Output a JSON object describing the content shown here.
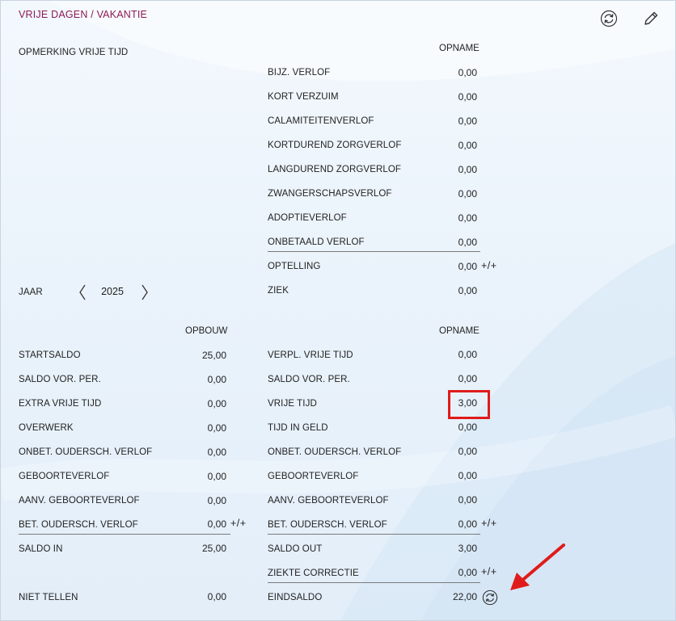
{
  "title": "VRIJE DAGEN / VAKANTIE",
  "icons": {
    "refresh": "refresh-icon",
    "edit": "pencil-icon"
  },
  "colors": {
    "title": "#8b1a55",
    "highlight": "#e01b1b"
  },
  "top": {
    "remark_label": "OPMERKING VRIJE TIJD",
    "opname_header": "OPNAME",
    "rows": [
      {
        "label": "BIJZ. VERLOF",
        "value": "0,00"
      },
      {
        "label": "KORT VERZUIM",
        "value": "0,00"
      },
      {
        "label": "CALAMITEITENVERLOF",
        "value": "0,00"
      },
      {
        "label": "KORTDUREND ZORGVERLOF",
        "value": "0,00"
      },
      {
        "label": "LANGDUREND ZORGVERLOF",
        "value": "0,00"
      },
      {
        "label": "ZWANGERSCHAPSVERLOF",
        "value": "0,00"
      },
      {
        "label": "ADOPTIEVERLOF",
        "value": "0,00"
      },
      {
        "label": "ONBETAALD VERLOF",
        "value": "0,00"
      },
      {
        "label": "OPTELLING",
        "value": "0,00",
        "suffix": "+/+"
      },
      {
        "label": "ZIEK",
        "value": "0,00"
      }
    ]
  },
  "year": {
    "label": "JAAR",
    "value": "2025"
  },
  "bottom": {
    "opbouw_header": "OPBOUW",
    "opname_header": "OPNAME",
    "left_rows": [
      {
        "label": "STARTSALDO",
        "value": "25,00"
      },
      {
        "label": "SALDO VOR. PER.",
        "value": "0,00"
      },
      {
        "label": "EXTRA VRIJE TIJD",
        "value": "0,00"
      },
      {
        "label": "OVERWERK",
        "value": "0,00"
      },
      {
        "label": "ONBET. OUDERSCH. VERLOF",
        "value": "0,00"
      },
      {
        "label": "GEBOORTEVERLOF",
        "value": "0,00"
      },
      {
        "label": "AANV. GEBOORTEVERLOF",
        "value": "0,00"
      },
      {
        "label": "BET. OUDERSCH. VERLOF",
        "value": "0,00",
        "suffix": "+/+"
      },
      {
        "label": "SALDO IN",
        "value": "25,00"
      }
    ],
    "right_rows": [
      {
        "label": "VERPL. VRIJE TIJD",
        "value": "0,00"
      },
      {
        "label": "SALDO VOR. PER.",
        "value": "0,00"
      },
      {
        "label": "VRIJE TIJD",
        "value": "3,00"
      },
      {
        "label": "TIJD IN GELD",
        "value": "0,00"
      },
      {
        "label": "ONBET. OUDERSCH. VERLOF",
        "value": "0,00"
      },
      {
        "label": "GEBOORTEVERLOF",
        "value": "0,00"
      },
      {
        "label": "AANV. GEBOORTEVERLOF",
        "value": "0,00"
      },
      {
        "label": "BET. OUDERSCH. VERLOF",
        "value": "0,00",
        "suffix": "+/+"
      },
      {
        "label": "SALDO OUT",
        "value": "3,00"
      },
      {
        "label": "ZIEKTE CORRECTIE",
        "value": "0,00",
        "suffix": "+/+"
      },
      {
        "label": "EINDSALDO",
        "value": "22,00"
      }
    ],
    "niet_tellen": {
      "label": "NIET TELLEN",
      "value": "0,00"
    }
  }
}
